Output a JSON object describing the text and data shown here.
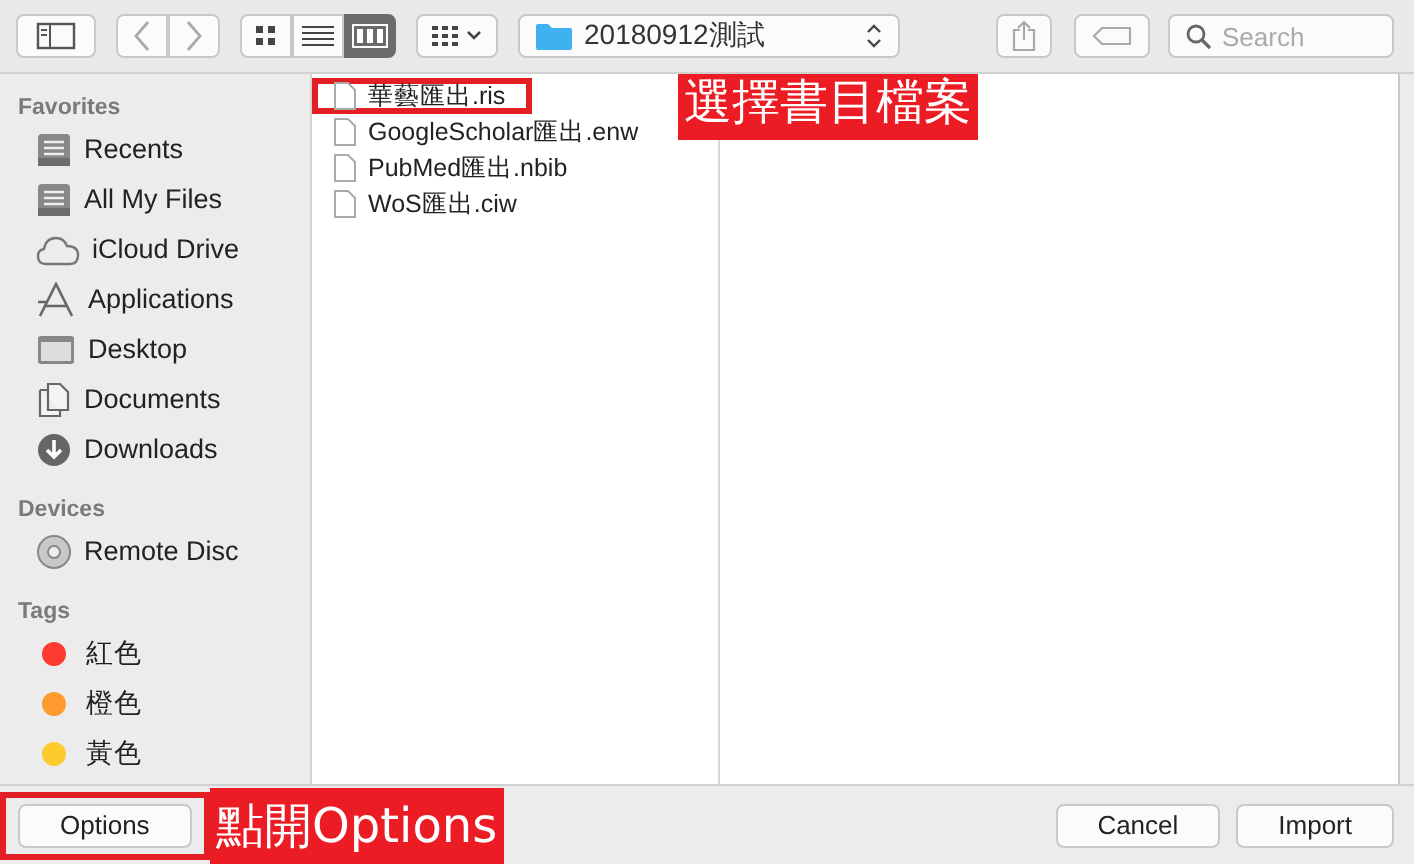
{
  "toolbar": {
    "view_modes": [
      {
        "kind": "icons",
        "selected": false
      },
      {
        "kind": "list",
        "selected": false
      },
      {
        "kind": "columns",
        "selected": true
      }
    ],
    "path": "20180912測試",
    "search": {
      "placeholder": "Search"
    }
  },
  "sidebar": {
    "sections": [
      {
        "title": "Favorites",
        "items": [
          {
            "label": "Recents",
            "kind": "tray"
          },
          {
            "label": "All My Files",
            "kind": "tray"
          },
          {
            "label": "iCloud Drive",
            "kind": "cloud"
          },
          {
            "label": "Applications",
            "kind": "apps"
          },
          {
            "label": "Desktop",
            "kind": "desktop"
          },
          {
            "label": "Documents",
            "kind": "documents"
          },
          {
            "label": "Downloads",
            "kind": "downloads"
          }
        ]
      },
      {
        "title": "Devices",
        "items": [
          {
            "label": "Remote Disc",
            "kind": "disc"
          }
        ]
      },
      {
        "title": "Tags",
        "items": [
          {
            "label": "紅色",
            "kind": "tag",
            "color": "#fe3b30"
          },
          {
            "label": "橙色",
            "kind": "tag",
            "color": "#fe9a2e"
          },
          {
            "label": "黃色",
            "kind": "tag",
            "color": "#fdcb2e"
          }
        ]
      }
    ]
  },
  "files": [
    {
      "name": "華藝匯出.ris",
      "boxed": true
    },
    {
      "name": "GoogleScholar匯出.enw",
      "boxed": false
    },
    {
      "name": "PubMed匯出.nbib",
      "boxed": false
    },
    {
      "name": "WoS匯出.ciw",
      "boxed": false
    }
  ],
  "buttons": {
    "options": {
      "label": "Options",
      "boxed": true
    },
    "cancel": "Cancel",
    "import": "Import"
  },
  "annotations": [
    {
      "text": "選擇書目檔案"
    },
    {
      "text": "點開Options"
    }
  ]
}
